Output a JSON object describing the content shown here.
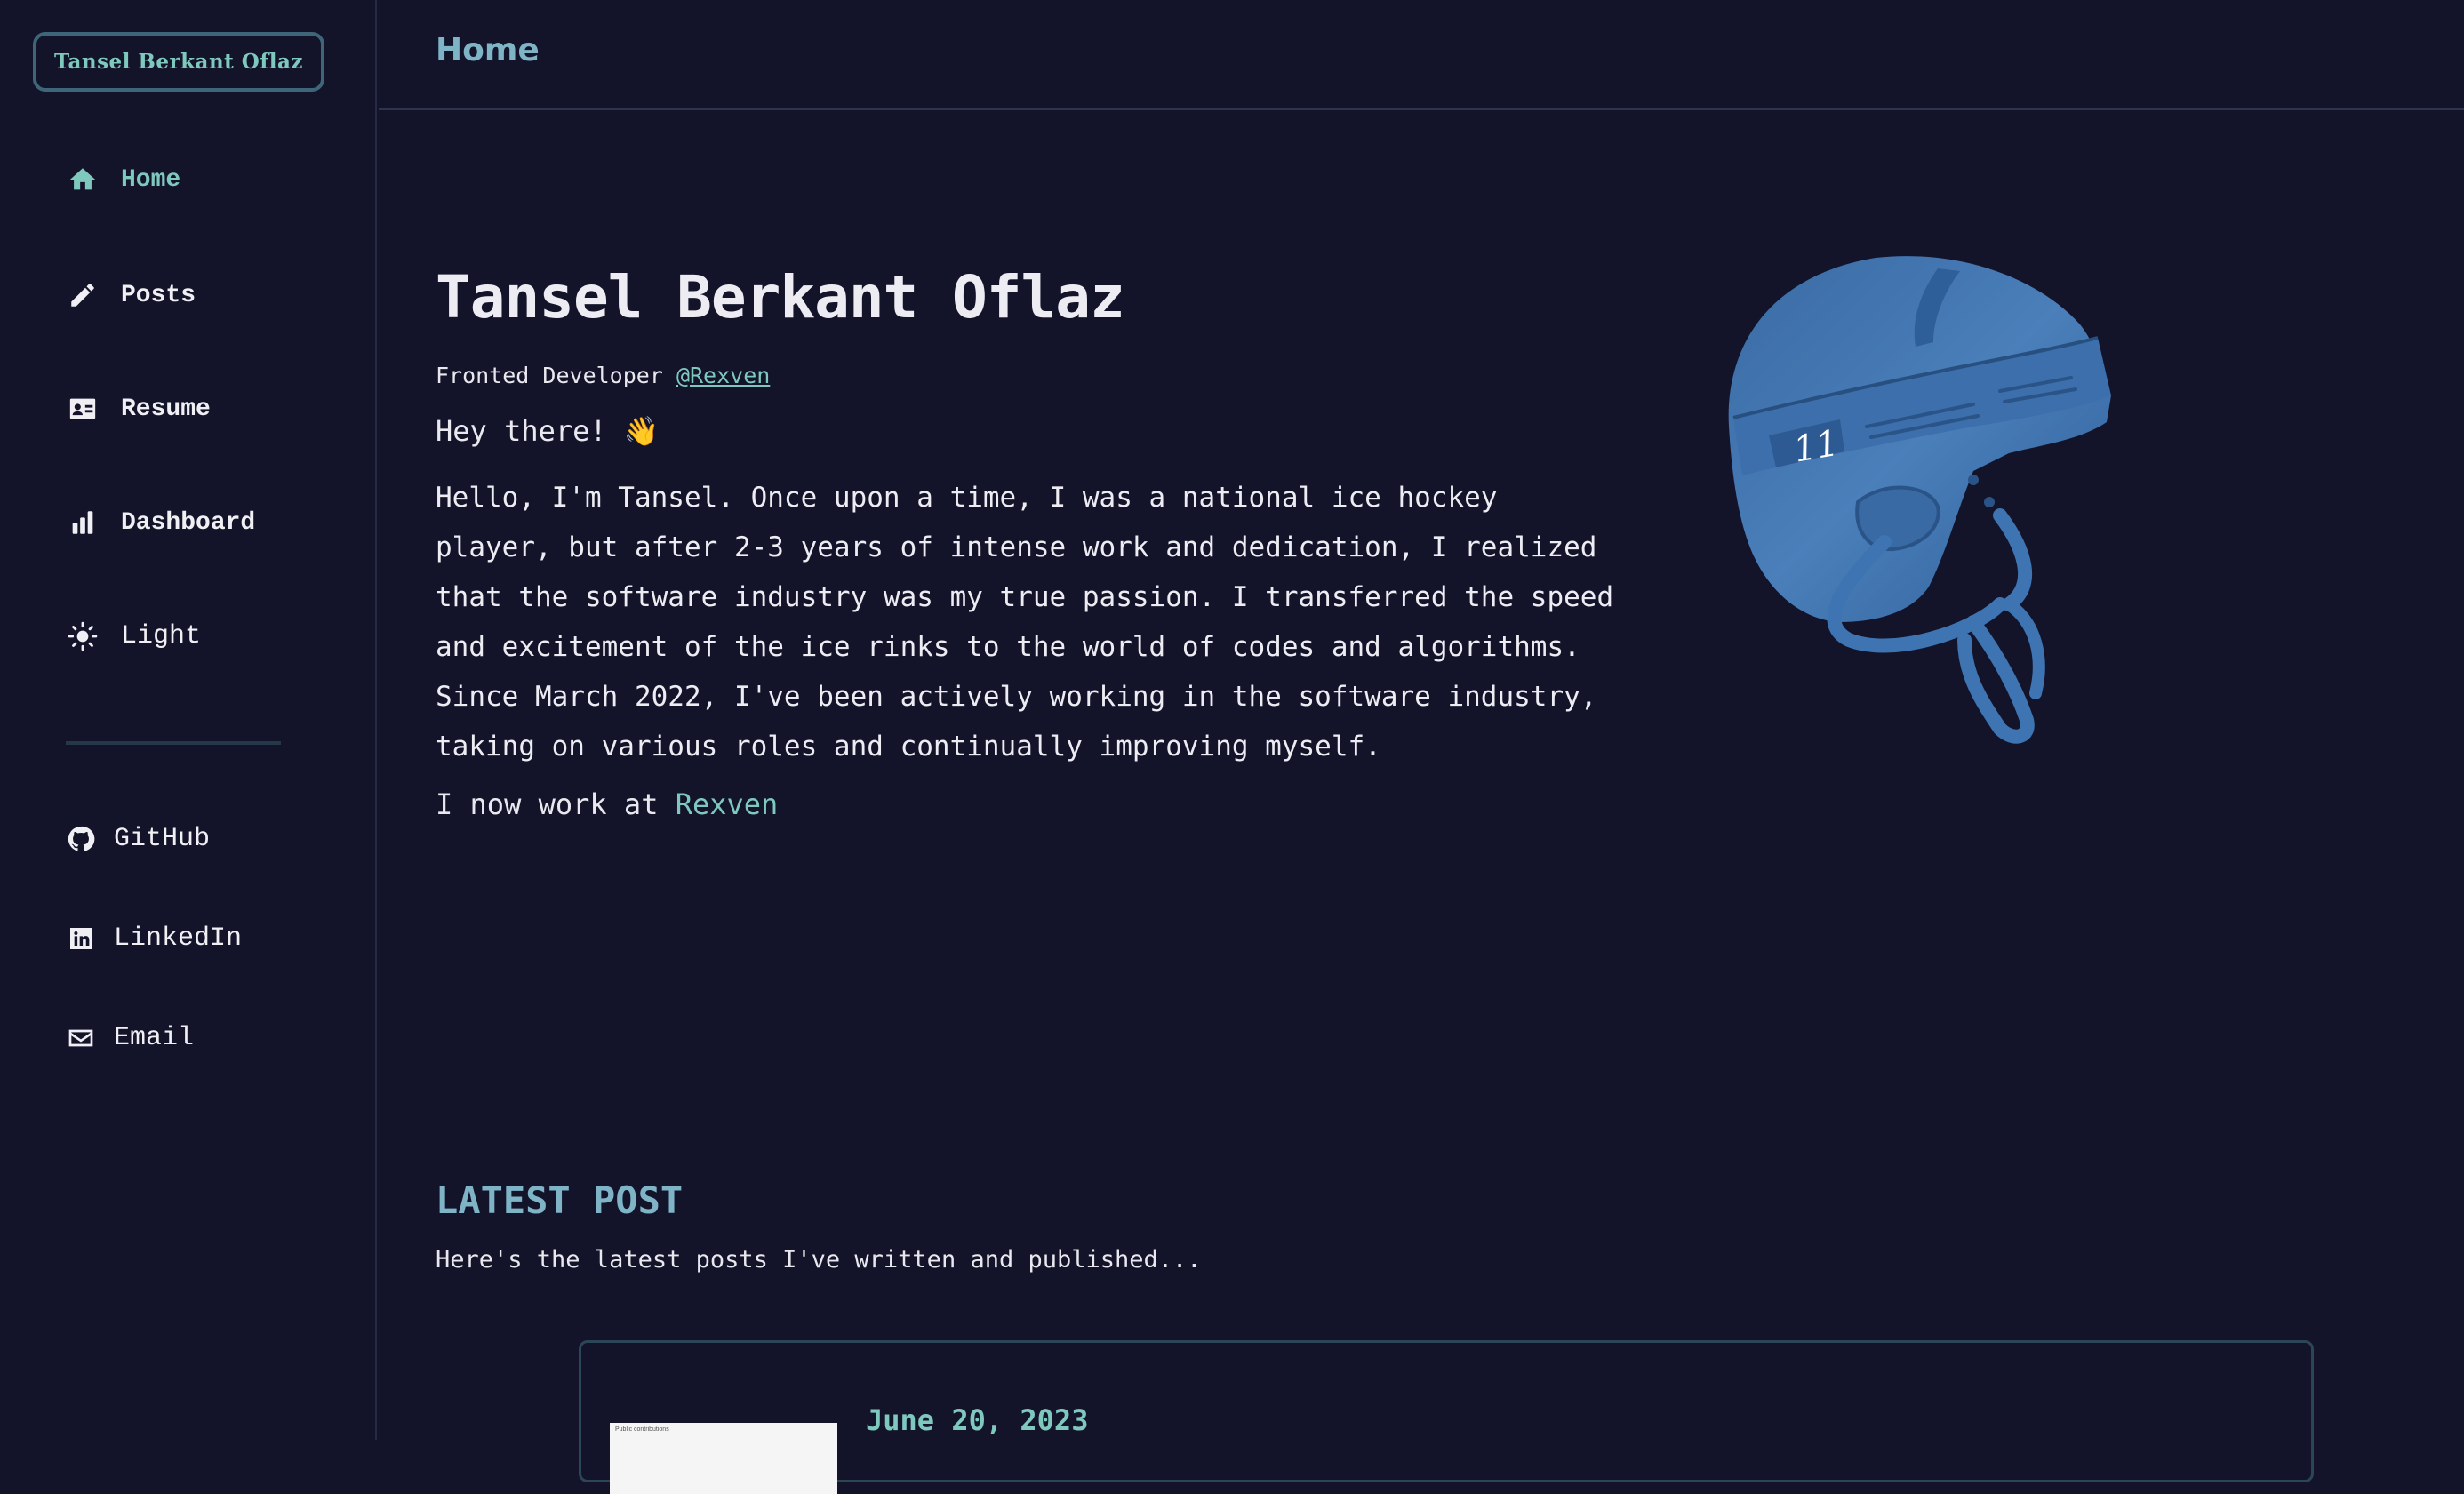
{
  "brand": {
    "name": "Tansel Berkant Oflaz"
  },
  "sidebar": {
    "nav": [
      {
        "label": "Home",
        "icon": "home-icon",
        "active": true
      },
      {
        "label": "Posts",
        "icon": "pencil-icon"
      },
      {
        "label": "Resume",
        "icon": "id-card-icon"
      },
      {
        "label": "Dashboard",
        "icon": "bar-chart-icon"
      },
      {
        "label": "Light",
        "icon": "sun-icon"
      }
    ],
    "social": [
      {
        "label": "GitHub",
        "icon": "github-icon"
      },
      {
        "label": "LinkedIn",
        "icon": "linkedin-icon"
      },
      {
        "label": "Email",
        "icon": "mail-icon"
      }
    ]
  },
  "header": {
    "title": "Home"
  },
  "hero": {
    "name": "Tansel Berkant Oflaz",
    "role": "Fronted Developer",
    "handle": "@Rexven",
    "greeting": "Hey there! 👋",
    "bio": "Hello, I'm Tansel. Once upon a time, I was a national ice hockey player, but after 2-3 years of intense work and dedication, I realized that the software industry was my true passion. I transferred the speed and excitement of the ice rinks to the world of codes and algorithms. Since March 2022, I've been actively working in the software industry, taking on various roles and continually improving myself.",
    "work_prefix": "I now work at",
    "work_company": "Rexven",
    "helmet_number": "11"
  },
  "latest": {
    "title": "LATEST POST",
    "subtitle": "Here's the latest posts I've written and published...",
    "post": {
      "date": "June 20, 2023",
      "thumb_text": "Public contributions"
    }
  },
  "colors": {
    "background": "#13132a",
    "accent": "#7ec8be",
    "heading_accent": "#7fb3c6",
    "helmet": "#4a7fba"
  }
}
